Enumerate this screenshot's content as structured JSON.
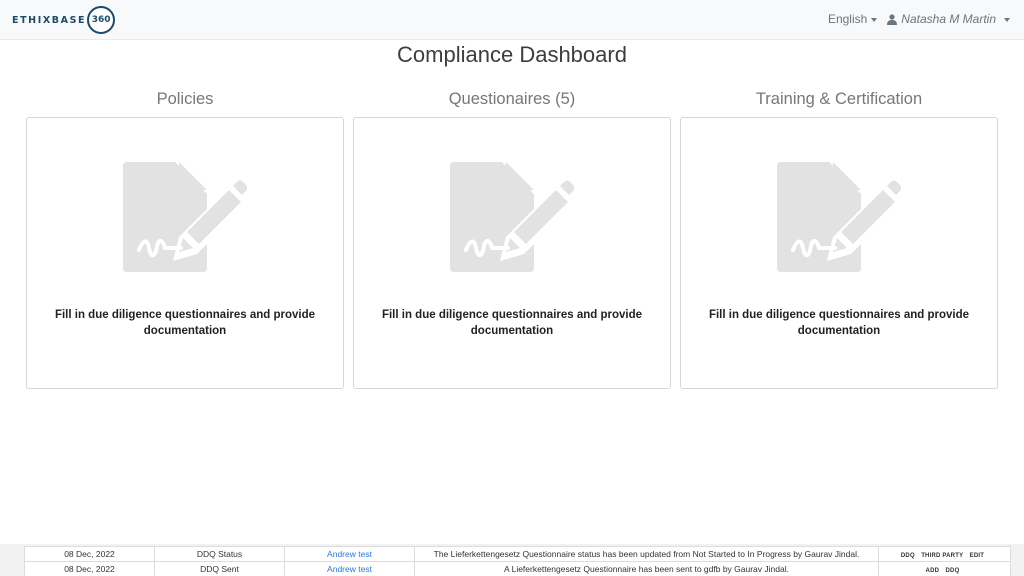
{
  "app": {
    "logo_text": "ETHIXBASE",
    "logo_number": "360"
  },
  "header": {
    "language": "English",
    "user_name": "Natasha M Martin"
  },
  "page": {
    "title": "Compliance Dashboard"
  },
  "columns": [
    {
      "title": "Policies",
      "card_text": "Fill in due diligence questionnaires and provide documentation"
    },
    {
      "title": "Questionaires (5)",
      "card_text": "Fill in due diligence questionnaires and provide documentation"
    },
    {
      "title": "Training & Certification",
      "card_text": "Fill in due diligence questionnaires and provide documentation"
    }
  ],
  "icons": {
    "card_icon": "document-signature-edit-icon",
    "user_icon": "user-icon",
    "icon_color": "#e2e2e2"
  },
  "activity": {
    "rows": [
      {
        "date": "08 Dec, 2022",
        "type": "DDQ Status",
        "user": "Andrew test",
        "message": "The Lieferkettengesetz Questionnaire status has been updated from Not Started to In Progress by Gaurav Jindal.",
        "tags": [
          "DDQ",
          "THIRD PARTY",
          "EDIT"
        ]
      },
      {
        "date": "08 Dec, 2022",
        "type": "DDQ Sent",
        "user": "Andrew test",
        "message": "A Lieferkettengesetz Questionnaire has been sent to gdfb by Gaurav Jindal.",
        "tags": [
          "ADD",
          "DDQ"
        ]
      }
    ]
  },
  "colors": {
    "brand": "#1b4a6b",
    "link": "#2a7ae2",
    "navbar_bg": "#f8f9fa"
  }
}
